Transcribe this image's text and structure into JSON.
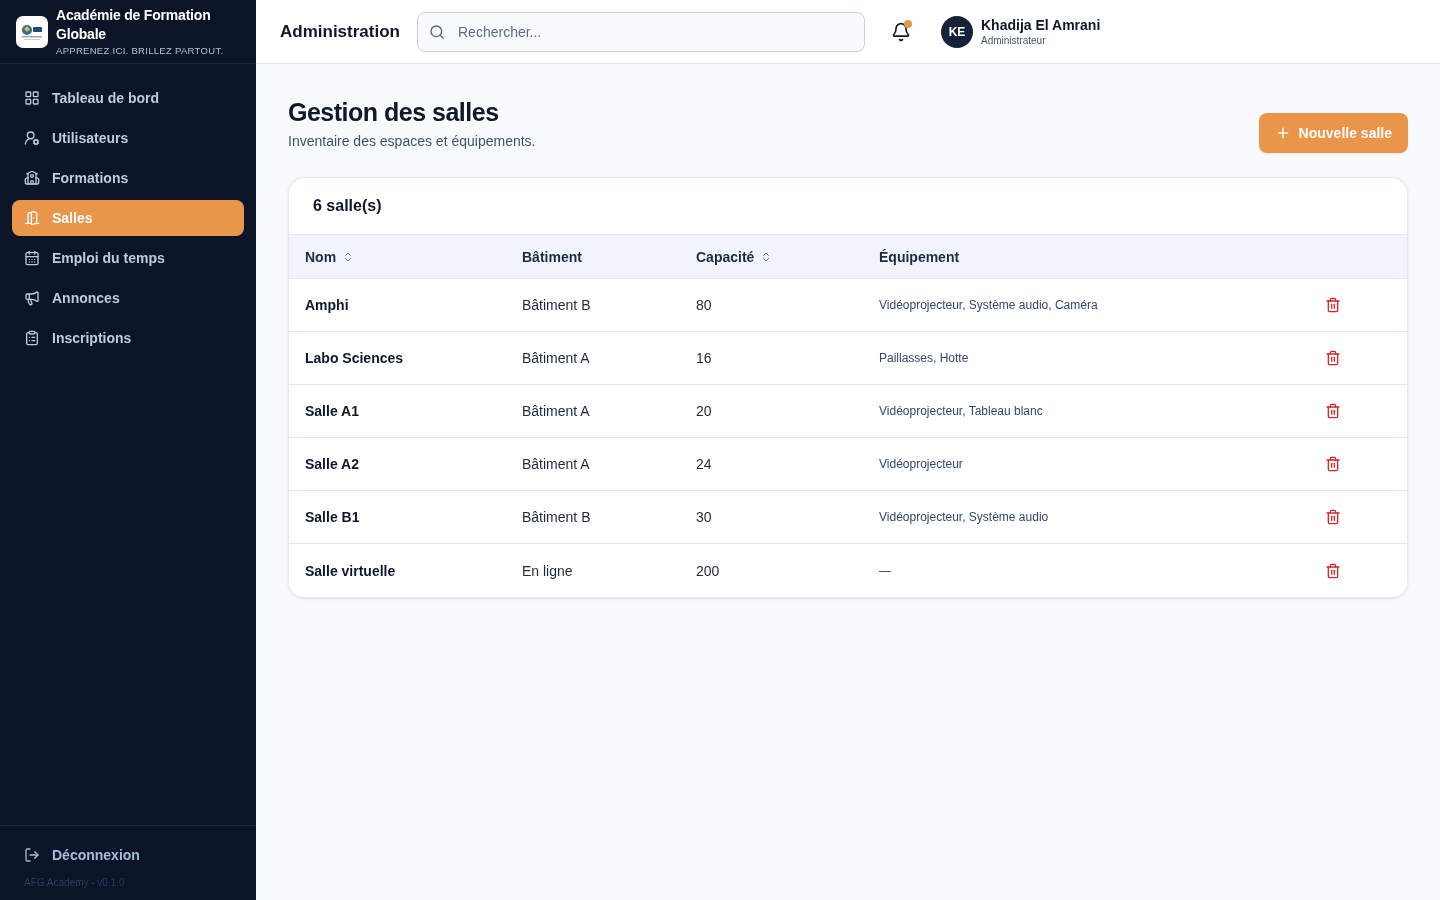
{
  "sidebar": {
    "brand": {
      "name": "Académie de Formation Globale",
      "tagline": "APPRENEZ ICI. BRILLEZ PARTOUT."
    },
    "nav": [
      {
        "label": "Tableau de bord",
        "kind": "dashboard",
        "selected": false
      },
      {
        "label": "Utilisateurs",
        "kind": "users",
        "selected": false
      },
      {
        "label": "Formations",
        "kind": "courses",
        "selected": false
      },
      {
        "label": "Salles",
        "kind": "rooms",
        "selected": true
      },
      {
        "label": "Emploi du temps",
        "kind": "calendar",
        "selected": false
      },
      {
        "label": "Annonces",
        "kind": "announcements",
        "selected": false
      },
      {
        "label": "Inscriptions",
        "kind": "enrollments",
        "selected": false
      }
    ],
    "logout": {
      "label": "Déconnexion"
    },
    "version": "AFG Academy - v0.1.0"
  },
  "header": {
    "title": "Administration",
    "search": {
      "placeholder": "Rechercher..."
    },
    "notifications": {
      "unread": true
    },
    "user": {
      "initials": "KE",
      "name": "Khadija El Amrani",
      "role": "Administrateur"
    }
  },
  "page": {
    "title": "Gestion des salles",
    "subtitle": "Inventaire des espaces et équipements.",
    "new_button": {
      "label": "Nouvelle salle"
    }
  },
  "table": {
    "count": "6 salle(s)",
    "columns": [
      {
        "label": "Nom",
        "sortable": true
      },
      {
        "label": "Bâtiment",
        "sortable": false
      },
      {
        "label": "Capacité",
        "sortable": true
      },
      {
        "label": "Équipement",
        "sortable": false
      }
    ],
    "rows": [
      {
        "name": "Amphi",
        "building": "Bâtiment B",
        "capacity": "80",
        "equipment": "Vidéoprojecteur, Système audio, Caméra"
      },
      {
        "name": "Labo Sciences",
        "building": "Bâtiment A",
        "capacity": "16",
        "equipment": "Paillasses, Hotte"
      },
      {
        "name": "Salle A1",
        "building": "Bâtiment A",
        "capacity": "20",
        "equipment": "Vidéoprojecteur, Tableau blanc"
      },
      {
        "name": "Salle A2",
        "building": "Bâtiment A",
        "capacity": "24",
        "equipment": "Vidéoprojecteur"
      },
      {
        "name": "Salle B1",
        "building": "Bâtiment B",
        "capacity": "30",
        "equipment": "Vidéoprojecteur, Système audio"
      },
      {
        "name": "Salle virtuelle",
        "building": "En ligne",
        "capacity": "200",
        "equipment": "—"
      }
    ]
  }
}
